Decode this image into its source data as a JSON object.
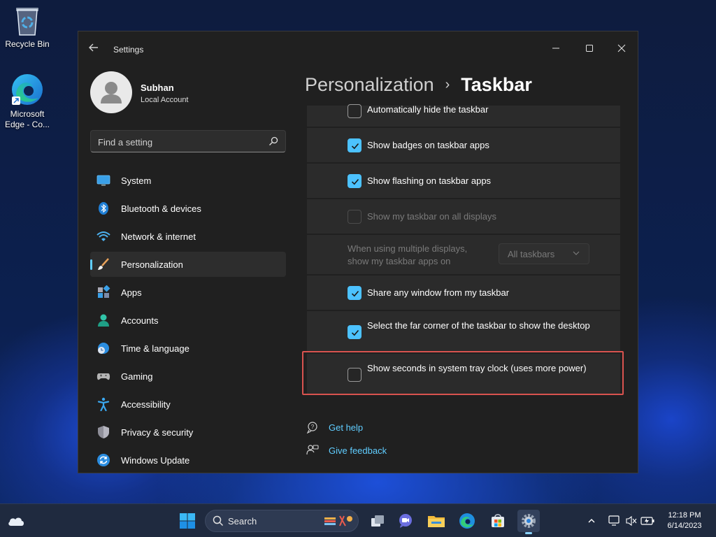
{
  "desktop": {
    "icons": [
      {
        "label": "Recycle Bin"
      },
      {
        "label": "Microsoft Edge - Co..."
      }
    ]
  },
  "window": {
    "title": "Settings",
    "user": {
      "name": "Subhan",
      "account_type": "Local Account"
    },
    "search": {
      "placeholder": "Find a setting"
    },
    "nav": [
      {
        "label": "System",
        "icon": "monitor-icon"
      },
      {
        "label": "Bluetooth & devices",
        "icon": "bluetooth-icon"
      },
      {
        "label": "Network & internet",
        "icon": "wifi-icon"
      },
      {
        "label": "Personalization",
        "icon": "brush-icon",
        "active": true
      },
      {
        "label": "Apps",
        "icon": "apps-icon"
      },
      {
        "label": "Accounts",
        "icon": "person-icon"
      },
      {
        "label": "Time & language",
        "icon": "globe-clock-icon"
      },
      {
        "label": "Gaming",
        "icon": "gamepad-icon"
      },
      {
        "label": "Accessibility",
        "icon": "accessibility-icon"
      },
      {
        "label": "Privacy & security",
        "icon": "shield-icon"
      },
      {
        "label": "Windows Update",
        "icon": "update-icon"
      }
    ],
    "breadcrumb": {
      "parent": "Personalization",
      "separator": "›",
      "current": "Taskbar"
    },
    "settings": [
      {
        "label": "Automatically hide the taskbar",
        "checked": false
      },
      {
        "label": "Show badges on taskbar apps",
        "checked": true
      },
      {
        "label": "Show flashing on taskbar apps",
        "checked": true
      },
      {
        "label": "Show my taskbar on all displays",
        "checked": false,
        "disabled": true
      },
      {
        "label": "When using multiple displays, show my taskbar apps on",
        "dropdown_value": "All taskbars",
        "disabled": true
      },
      {
        "label": "Share any window from my taskbar",
        "checked": true
      },
      {
        "label": "Select the far corner of the taskbar to show the desktop",
        "checked": true
      },
      {
        "label": "Show seconds in system tray clock (uses more power)",
        "checked": false,
        "highlighted": true
      }
    ],
    "links": {
      "help": "Get help",
      "feedback": "Give feedback"
    }
  },
  "taskbar": {
    "search_label": "Search",
    "clock": {
      "time": "12:18 PM",
      "date": "6/14/2023"
    }
  },
  "colors": {
    "accent": "#4cc2ff",
    "link": "#60cdff",
    "highlight": "#d9534f"
  }
}
